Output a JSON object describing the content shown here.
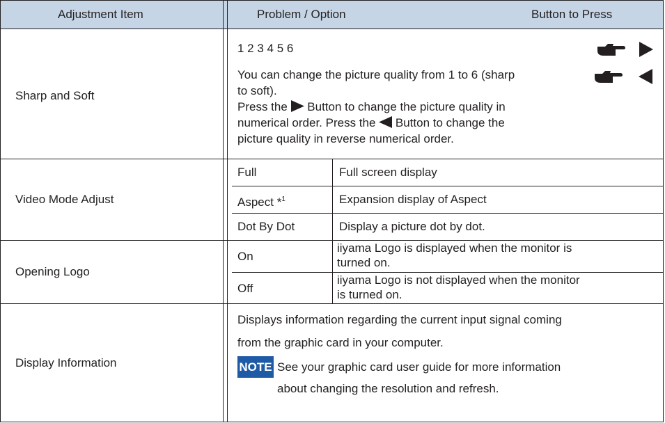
{
  "header": {
    "col1": "Adjustment Item",
    "col2": "Problem / Option",
    "col3": "Button to Press"
  },
  "rows": {
    "sharp": {
      "item": "Sharp and Soft",
      "options": "1 2 3 4 5 6",
      "desc_a": "You can change the picture quality from 1 to 6 (sharp",
      "desc_b": "to soft).",
      "press_1": "Press the",
      "press_2": "Button to change the picture quality in",
      "press_3": "numerical order. Press the",
      "press_4": "Button to change the",
      "press_5": "picture quality in reverse numerical order.",
      "buttons": [
        "hand-right-icon",
        "triangle-right-icon",
        "hand-right-icon",
        "triangle-left-icon"
      ]
    },
    "video": {
      "item": "Video Mode Adjust",
      "options": [
        {
          "name": "Full",
          "desc": "Full screen display"
        },
        {
          "name": "Aspect *",
          "sup": "1",
          "desc": "Expansion display of Aspect"
        },
        {
          "name": "Dot By Dot",
          "desc": "Display a picture dot by dot."
        }
      ]
    },
    "logo": {
      "item": "Opening Logo",
      "options": [
        {
          "name": "On",
          "desc_a": "iiyama Logo is displayed when the monitor is",
          "desc_b": "turned on."
        },
        {
          "name": "Off",
          "desc_a": "iiyama Logo is not displayed when the monitor",
          "desc_b": "is turned on."
        }
      ]
    },
    "info": {
      "item": "Display Information",
      "desc_a": "Displays information regarding the current input signal coming",
      "desc_b": "from the graphic card in your computer.",
      "note_label": "NOTE",
      "note_a": "See your graphic card user guide for more information",
      "note_b": "about changing the resolution and refresh."
    }
  },
  "colors": {
    "header_bg": "#c5d5e6",
    "note_bg": "#1f5aa6",
    "text": "#231f20"
  }
}
